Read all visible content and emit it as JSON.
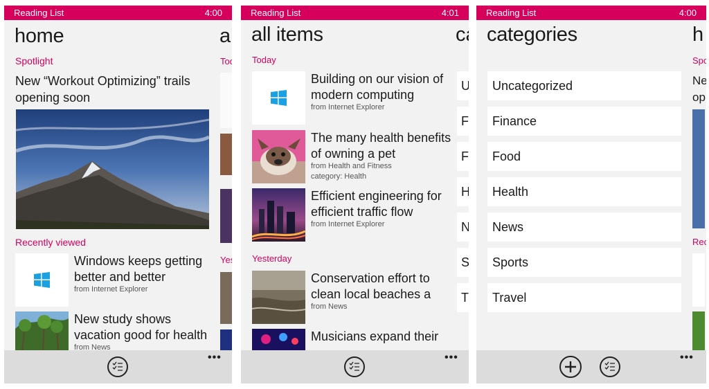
{
  "colors": {
    "accent": "#d6005c",
    "panel": "#f2f2f2",
    "appbar": "#dcdcdc"
  },
  "screens": {
    "home": {
      "status": {
        "app": "Reading List",
        "time": "4:00"
      },
      "title": "home",
      "peek_title": "al",
      "spotlight_label": "Spotlight",
      "spotlight_headline": "New “Workout Optimizing” trails opening soon",
      "recent_label": "Recently viewed",
      "peek_today": "Tod",
      "peek_yesterday": "Yes",
      "items": [
        {
          "title": [
            "Windows keeps getting",
            "better and better"
          ],
          "source": "from Internet Explorer",
          "icon": "windows-logo-icon"
        },
        {
          "title": [
            "New study shows",
            "vacation good for health"
          ],
          "source": "from News",
          "icon": "palm-trees-photo"
        }
      ],
      "appbar_icon": "checklist-icon",
      "more": "•••"
    },
    "all_items": {
      "status": {
        "app": "Reading List",
        "time": "4:01"
      },
      "title": "all items",
      "peek_title": "ca",
      "today_label": "Today",
      "yesterday_label": "Yesterday",
      "today_items": [
        {
          "title": [
            "Building on our vision of",
            "modern computing"
          ],
          "source": "from Internet Explorer",
          "category": "",
          "icon": "windows-logo-icon"
        },
        {
          "title": [
            "The many health benefits",
            "of owning a pet"
          ],
          "source": "from Health and Fitness",
          "category": "category: Health",
          "icon": "dog-photo"
        },
        {
          "title": [
            "Efficient engineering for",
            "efficient traffic flow"
          ],
          "source": "from Internet Explorer",
          "category": "",
          "icon": "city-night-photo"
        }
      ],
      "yesterday_items": [
        {
          "title": [
            "Conservation effort to",
            "clean local beaches a"
          ],
          "source": "from News",
          "icon": "beach-photo"
        },
        {
          "title": [
            "Musicians expand their",
            ""
          ],
          "source": "",
          "icon": "concert-photo"
        }
      ],
      "peek_letters": [
        "U",
        "F",
        "Fo",
        "H",
        "N",
        "S",
        "T"
      ],
      "appbar_icon": "checklist-icon",
      "more": "•••"
    },
    "categories": {
      "status": {
        "app": "Reading List",
        "time": "4:00"
      },
      "title": "categories",
      "peek_title": "h",
      "peek_spotlight": "Spo",
      "peek_headline": [
        "Ne",
        "op"
      ],
      "peek_recent": "Rec",
      "items": [
        "Uncategorized",
        "Finance",
        "Food",
        "Health",
        "News",
        "Sports",
        "Travel"
      ],
      "appbar_icons": [
        "add-icon",
        "checklist-icon"
      ],
      "more": "•••"
    }
  }
}
